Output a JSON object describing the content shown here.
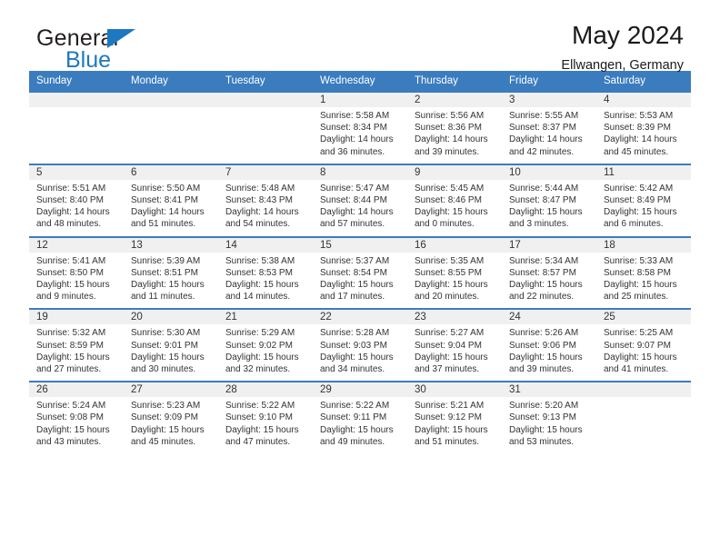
{
  "brand": {
    "name_top": "General",
    "name_bottom": "Blue",
    "accent_color": "#1d78c1"
  },
  "header": {
    "title": "May 2024",
    "subtitle": "Ellwangen, Germany"
  },
  "theme": {
    "header_blue": "#3b7cbf",
    "date_band": "#f0f0f0",
    "text": "#333333"
  },
  "calendar": {
    "weekday_headers": [
      "Sunday",
      "Monday",
      "Tuesday",
      "Wednesday",
      "Thursday",
      "Friday",
      "Saturday"
    ],
    "labels": {
      "sunrise": "Sunrise:",
      "sunset": "Sunset:",
      "daylight": "Daylight:"
    },
    "weeks": [
      [
        {
          "day": "",
          "lines": [
            "",
            "",
            "",
            ""
          ]
        },
        {
          "day": "",
          "lines": [
            "",
            "",
            "",
            ""
          ]
        },
        {
          "day": "",
          "lines": [
            "",
            "",
            "",
            ""
          ]
        },
        {
          "day": "1",
          "lines": [
            "Sunrise: 5:58 AM",
            "Sunset: 8:34 PM",
            "Daylight: 14 hours",
            "and 36 minutes."
          ]
        },
        {
          "day": "2",
          "lines": [
            "Sunrise: 5:56 AM",
            "Sunset: 8:36 PM",
            "Daylight: 14 hours",
            "and 39 minutes."
          ]
        },
        {
          "day": "3",
          "lines": [
            "Sunrise: 5:55 AM",
            "Sunset: 8:37 PM",
            "Daylight: 14 hours",
            "and 42 minutes."
          ]
        },
        {
          "day": "4",
          "lines": [
            "Sunrise: 5:53 AM",
            "Sunset: 8:39 PM",
            "Daylight: 14 hours",
            "and 45 minutes."
          ]
        }
      ],
      [
        {
          "day": "5",
          "lines": [
            "Sunrise: 5:51 AM",
            "Sunset: 8:40 PM",
            "Daylight: 14 hours",
            "and 48 minutes."
          ]
        },
        {
          "day": "6",
          "lines": [
            "Sunrise: 5:50 AM",
            "Sunset: 8:41 PM",
            "Daylight: 14 hours",
            "and 51 minutes."
          ]
        },
        {
          "day": "7",
          "lines": [
            "Sunrise: 5:48 AM",
            "Sunset: 8:43 PM",
            "Daylight: 14 hours",
            "and 54 minutes."
          ]
        },
        {
          "day": "8",
          "lines": [
            "Sunrise: 5:47 AM",
            "Sunset: 8:44 PM",
            "Daylight: 14 hours",
            "and 57 minutes."
          ]
        },
        {
          "day": "9",
          "lines": [
            "Sunrise: 5:45 AM",
            "Sunset: 8:46 PM",
            "Daylight: 15 hours",
            "and 0 minutes."
          ]
        },
        {
          "day": "10",
          "lines": [
            "Sunrise: 5:44 AM",
            "Sunset: 8:47 PM",
            "Daylight: 15 hours",
            "and 3 minutes."
          ]
        },
        {
          "day": "11",
          "lines": [
            "Sunrise: 5:42 AM",
            "Sunset: 8:49 PM",
            "Daylight: 15 hours",
            "and 6 minutes."
          ]
        }
      ],
      [
        {
          "day": "12",
          "lines": [
            "Sunrise: 5:41 AM",
            "Sunset: 8:50 PM",
            "Daylight: 15 hours",
            "and 9 minutes."
          ]
        },
        {
          "day": "13",
          "lines": [
            "Sunrise: 5:39 AM",
            "Sunset: 8:51 PM",
            "Daylight: 15 hours",
            "and 11 minutes."
          ]
        },
        {
          "day": "14",
          "lines": [
            "Sunrise: 5:38 AM",
            "Sunset: 8:53 PM",
            "Daylight: 15 hours",
            "and 14 minutes."
          ]
        },
        {
          "day": "15",
          "lines": [
            "Sunrise: 5:37 AM",
            "Sunset: 8:54 PM",
            "Daylight: 15 hours",
            "and 17 minutes."
          ]
        },
        {
          "day": "16",
          "lines": [
            "Sunrise: 5:35 AM",
            "Sunset: 8:55 PM",
            "Daylight: 15 hours",
            "and 20 minutes."
          ]
        },
        {
          "day": "17",
          "lines": [
            "Sunrise: 5:34 AM",
            "Sunset: 8:57 PM",
            "Daylight: 15 hours",
            "and 22 minutes."
          ]
        },
        {
          "day": "18",
          "lines": [
            "Sunrise: 5:33 AM",
            "Sunset: 8:58 PM",
            "Daylight: 15 hours",
            "and 25 minutes."
          ]
        }
      ],
      [
        {
          "day": "19",
          "lines": [
            "Sunrise: 5:32 AM",
            "Sunset: 8:59 PM",
            "Daylight: 15 hours",
            "and 27 minutes."
          ]
        },
        {
          "day": "20",
          "lines": [
            "Sunrise: 5:30 AM",
            "Sunset: 9:01 PM",
            "Daylight: 15 hours",
            "and 30 minutes."
          ]
        },
        {
          "day": "21",
          "lines": [
            "Sunrise: 5:29 AM",
            "Sunset: 9:02 PM",
            "Daylight: 15 hours",
            "and 32 minutes."
          ]
        },
        {
          "day": "22",
          "lines": [
            "Sunrise: 5:28 AM",
            "Sunset: 9:03 PM",
            "Daylight: 15 hours",
            "and 34 minutes."
          ]
        },
        {
          "day": "23",
          "lines": [
            "Sunrise: 5:27 AM",
            "Sunset: 9:04 PM",
            "Daylight: 15 hours",
            "and 37 minutes."
          ]
        },
        {
          "day": "24",
          "lines": [
            "Sunrise: 5:26 AM",
            "Sunset: 9:06 PM",
            "Daylight: 15 hours",
            "and 39 minutes."
          ]
        },
        {
          "day": "25",
          "lines": [
            "Sunrise: 5:25 AM",
            "Sunset: 9:07 PM",
            "Daylight: 15 hours",
            "and 41 minutes."
          ]
        }
      ],
      [
        {
          "day": "26",
          "lines": [
            "Sunrise: 5:24 AM",
            "Sunset: 9:08 PM",
            "Daylight: 15 hours",
            "and 43 minutes."
          ]
        },
        {
          "day": "27",
          "lines": [
            "Sunrise: 5:23 AM",
            "Sunset: 9:09 PM",
            "Daylight: 15 hours",
            "and 45 minutes."
          ]
        },
        {
          "day": "28",
          "lines": [
            "Sunrise: 5:22 AM",
            "Sunset: 9:10 PM",
            "Daylight: 15 hours",
            "and 47 minutes."
          ]
        },
        {
          "day": "29",
          "lines": [
            "Sunrise: 5:22 AM",
            "Sunset: 9:11 PM",
            "Daylight: 15 hours",
            "and 49 minutes."
          ]
        },
        {
          "day": "30",
          "lines": [
            "Sunrise: 5:21 AM",
            "Sunset: 9:12 PM",
            "Daylight: 15 hours",
            "and 51 minutes."
          ]
        },
        {
          "day": "31",
          "lines": [
            "Sunrise: 5:20 AM",
            "Sunset: 9:13 PM",
            "Daylight: 15 hours",
            "and 53 minutes."
          ]
        },
        {
          "day": "",
          "lines": [
            "",
            "",
            "",
            ""
          ]
        }
      ]
    ]
  }
}
